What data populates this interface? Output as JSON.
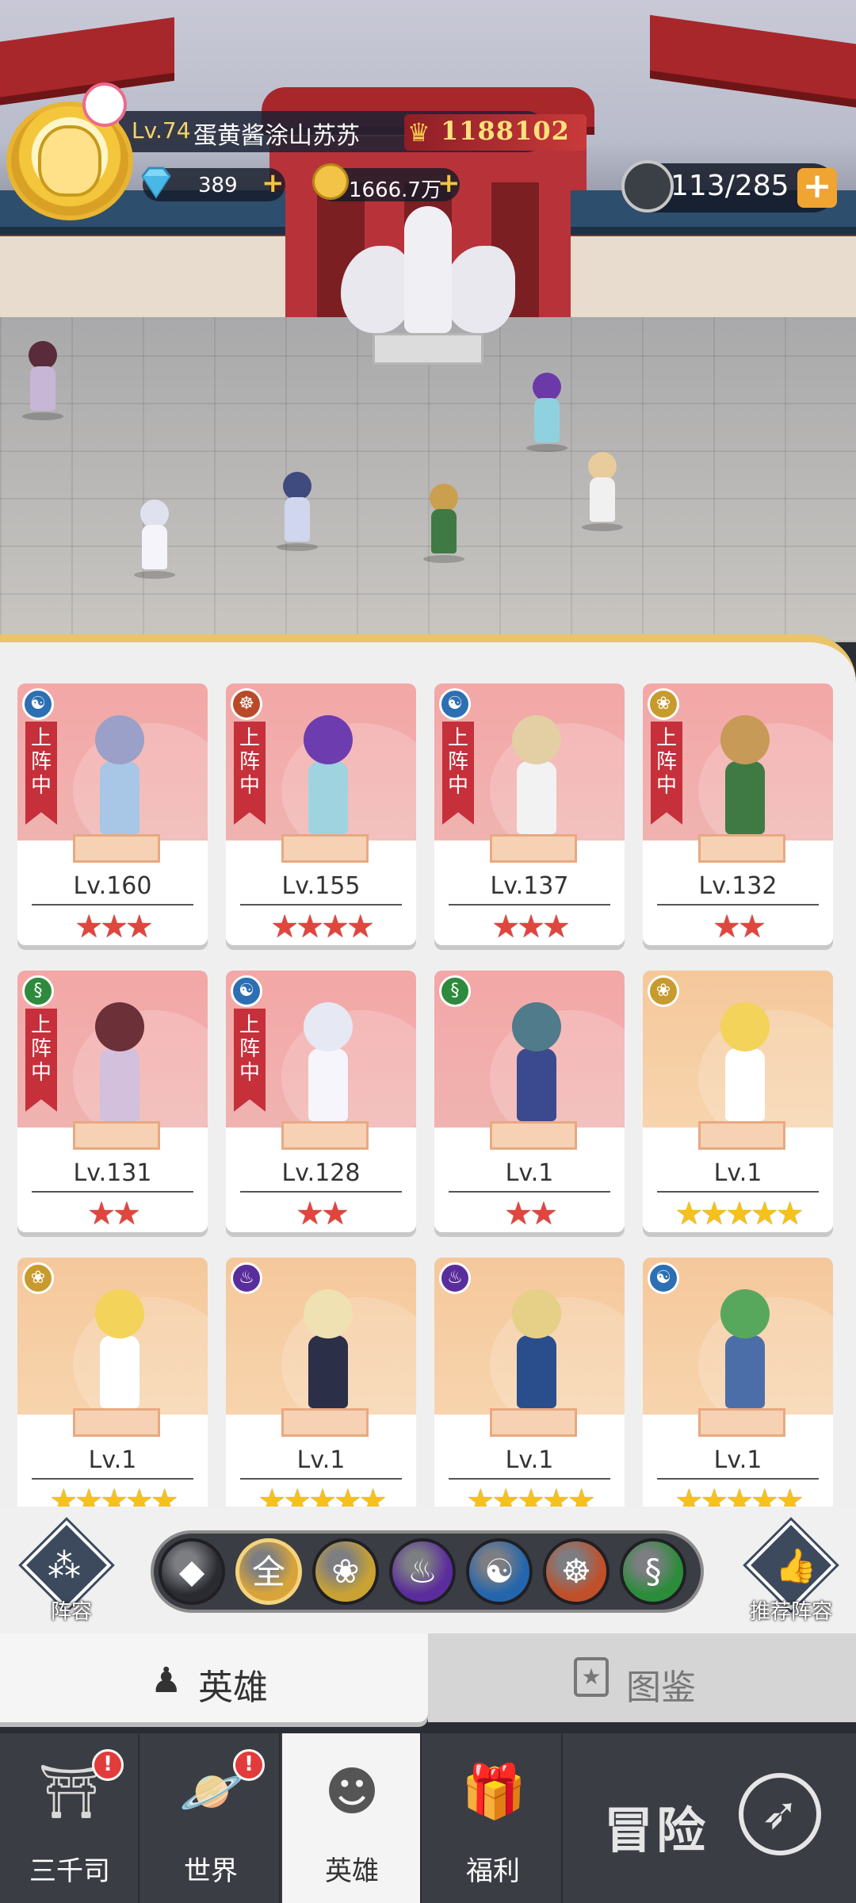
{
  "player": {
    "level": "Lv.74",
    "name": "蛋黄酱涂山苏苏",
    "power": "1188102"
  },
  "resources": {
    "gems": "389",
    "gold": "1666.7万",
    "stamina": "113/285",
    "plus": "+"
  },
  "heroes": [
    {
      "level": "Lv.160",
      "stars": "★★★",
      "deployed_label": "上阵中",
      "element_icon": "swirl-icon",
      "element_glyph": "☯",
      "badge_color": "#2d6fb3",
      "star_color": "red",
      "card": "red"
    },
    {
      "level": "Lv.155",
      "stars": "★★★★",
      "deployed_label": "上阵中",
      "element_icon": "meditate-icon",
      "element_glyph": "☸",
      "badge_color": "#b84a2a",
      "star_color": "red",
      "card": "red"
    },
    {
      "level": "Lv.137",
      "stars": "★★★",
      "deployed_label": "上阵中",
      "element_icon": "swirl-icon",
      "element_glyph": "☯",
      "badge_color": "#2d6fb3",
      "star_color": "red",
      "card": "red"
    },
    {
      "level": "Lv.132",
      "stars": "★★",
      "deployed_label": "上阵中",
      "element_icon": "lotus-icon",
      "element_glyph": "❀",
      "badge_color": "#c79b2e",
      "star_color": "red",
      "card": "red"
    },
    {
      "level": "Lv.131",
      "stars": "★★",
      "deployed_label": "上阵中",
      "element_icon": "dna-icon",
      "element_glyph": "§",
      "badge_color": "#2e8a3c",
      "star_color": "red",
      "card": "red"
    },
    {
      "level": "Lv.128",
      "stars": "★★",
      "deployed_label": "上阵中",
      "element_icon": "swirl-icon",
      "element_glyph": "☯",
      "badge_color": "#2d6fb3",
      "star_color": "red",
      "card": "red"
    },
    {
      "level": "Lv.1",
      "stars": "★★",
      "deployed_label": "",
      "element_icon": "dna-icon",
      "element_glyph": "§",
      "badge_color": "#2e8a3c",
      "star_color": "red",
      "card": "red"
    },
    {
      "level": "Lv.1",
      "stars": "★★★★★",
      "deployed_label": "",
      "element_icon": "lotus-icon",
      "element_glyph": "❀",
      "badge_color": "#c79b2e",
      "star_color": "yellow",
      "card": "gold"
    },
    {
      "level": "Lv.1",
      "stars": "★★★★★",
      "deployed_label": "",
      "element_icon": "lotus-icon",
      "element_glyph": "❀",
      "badge_color": "#c79b2e",
      "star_color": "yellow",
      "card": "gold"
    },
    {
      "level": "Lv.1",
      "stars": "★★★★★",
      "deployed_label": "",
      "element_icon": "flame-icon",
      "element_glyph": "♨",
      "badge_color": "#5a2d9c",
      "star_color": "yellow",
      "card": "gold"
    },
    {
      "level": "Lv.1",
      "stars": "★★★★★",
      "deployed_label": "",
      "element_icon": "flame-icon",
      "element_glyph": "♨",
      "badge_color": "#5a2d9c",
      "star_color": "yellow",
      "card": "gold"
    },
    {
      "level": "Lv.1",
      "stars": "★★★★★",
      "deployed_label": "",
      "element_icon": "swirl-icon",
      "element_glyph": "☯",
      "badge_color": "#2d6fb3",
      "star_color": "yellow",
      "card": "gold"
    }
  ],
  "filters": {
    "lineup_label": "阵容",
    "recommend_label": "推荐阵容",
    "elements": [
      {
        "name": "element-filter-diamond",
        "glyph": "◆",
        "color": "#2a2b30"
      },
      {
        "name": "element-filter-all",
        "glyph": "全",
        "color": "#d8a43a"
      },
      {
        "name": "element-filter-lotus",
        "glyph": "❀",
        "color": "#c9a233"
      },
      {
        "name": "element-filter-flame",
        "glyph": "♨",
        "color": "#5b2c9d"
      },
      {
        "name": "element-filter-swirl",
        "glyph": "☯",
        "color": "#2466ad"
      },
      {
        "name": "element-filter-meditate",
        "glyph": "☸",
        "color": "#c0502a"
      },
      {
        "name": "element-filter-dna",
        "glyph": "§",
        "color": "#2b8c3a"
      }
    ]
  },
  "tabs": {
    "hero": "英雄",
    "codex": "图鉴"
  },
  "nav": {
    "sanqiansi": "三千司",
    "world": "世界",
    "hero": "英雄",
    "welfare": "福利",
    "adventure": "冒险",
    "alert": "!"
  }
}
